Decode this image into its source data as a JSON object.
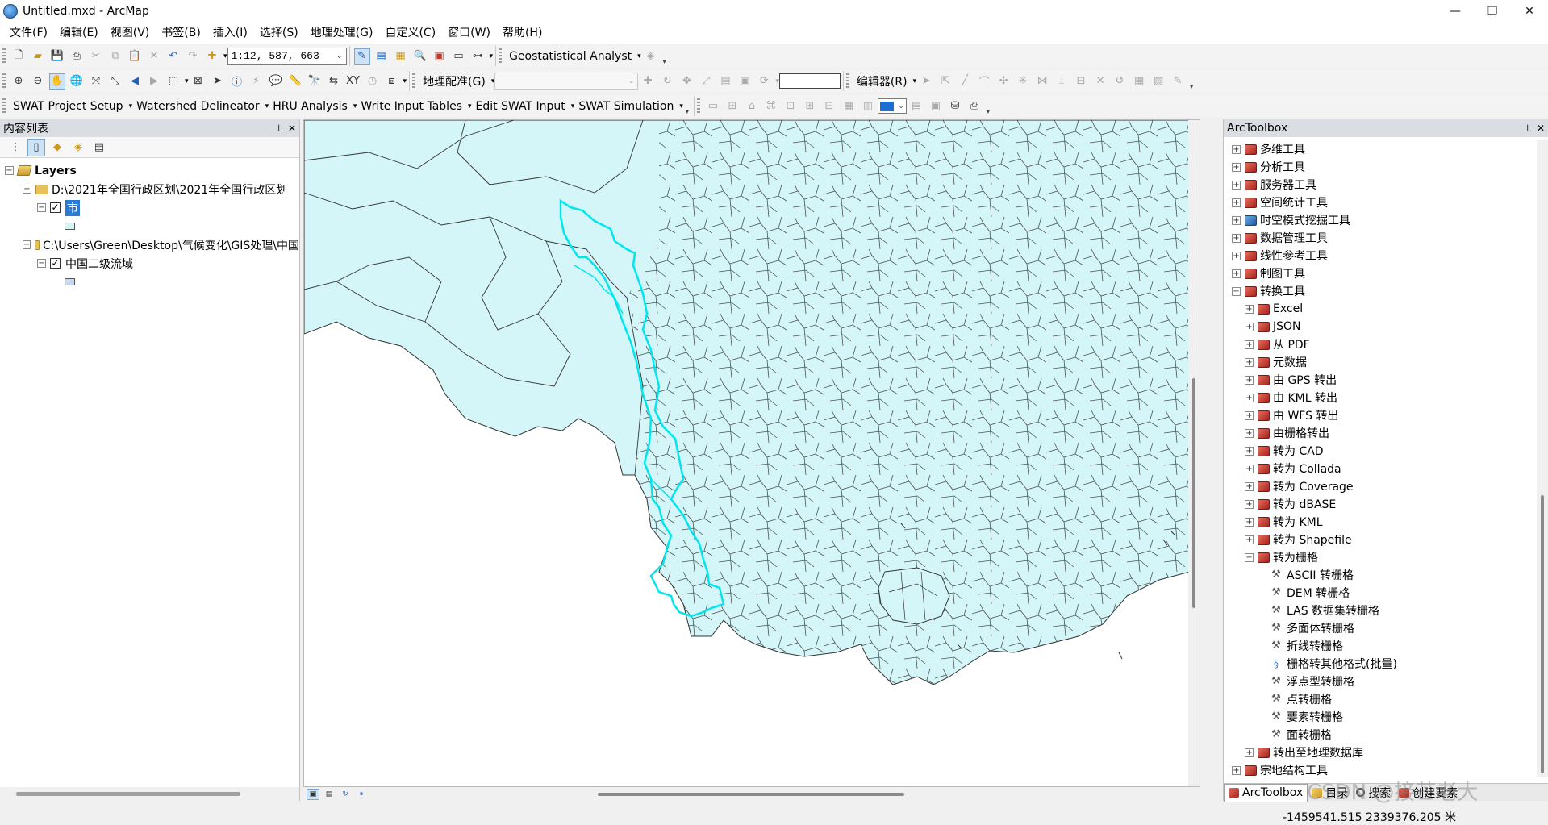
{
  "window": {
    "title": "Untitled.mxd - ArcMap",
    "minimize": "—",
    "maximize": "❐",
    "close": "✕"
  },
  "menu": [
    "文件(F)",
    "编辑(E)",
    "视图(V)",
    "书签(B)",
    "插入(I)",
    "选择(S)",
    "地理处理(G)",
    "自定义(C)",
    "窗口(W)",
    "帮助(H)"
  ],
  "standard_toolbar": {
    "scale": "1:12, 587, 663",
    "geostatistical": "Geostatistical Analyst"
  },
  "tools_toolbar": {
    "georeferencing": "地理配准(G)",
    "editor": "编辑器(R)"
  },
  "swat_toolbar": {
    "items": [
      "SWAT Project Setup",
      "Watershed Delineator",
      "HRU Analysis",
      "Write Input Tables",
      "Edit SWAT Input",
      "SWAT Simulation"
    ]
  },
  "toc": {
    "title": "内容列表",
    "root": "Layers",
    "group1": "D:\\2021年全国行政区划\\2021年全国行政区划",
    "layer1": "市",
    "group2": "C:\\Users\\Green\\Desktop\\气候变化\\GIS处理\\中国",
    "layer2": "中国二级流域",
    "colors": {
      "layer1_fill": "#d4f6f8",
      "layer2_fill": "#c8d8f0"
    }
  },
  "map": {
    "land_fill": "#d4f6f8",
    "boundary_color": "#333333",
    "basin_outline_color": "#00e5ee"
  },
  "toolbox": {
    "title": "ArcToolbox",
    "top_items": [
      "多维工具",
      "分析工具",
      "服务器工具",
      "空间统计工具",
      "时空模式挖掘工具",
      "数据管理工具",
      "线性参考工具",
      "制图工具"
    ],
    "conversion": "转换工具",
    "conversion_children": [
      "Excel",
      "JSON",
      "从 PDF",
      "元数据",
      "由 GPS 转出",
      "由 KML 转出",
      "由 WFS 转出",
      "由栅格转出",
      "转为 CAD",
      "转为 Collada",
      "转为 Coverage",
      "转为 dBASE",
      "转为 KML",
      "转为 Shapefile"
    ],
    "to_raster": "转为栅格",
    "to_raster_tools": [
      "ASCII 转栅格",
      "DEM 转栅格",
      "LAS 数据集转栅格",
      "多面体转栅格",
      "折线转栅格",
      "栅格转其他格式(批量)",
      "浮点型转栅格",
      "点转栅格",
      "要素转栅格",
      "面转栅格"
    ],
    "to_geodatabase": "转出至地理数据库",
    "parcel_tools": "宗地结构工具",
    "tabs": [
      "ArcToolbox",
      "目录",
      "搜索",
      "创建要素"
    ]
  },
  "status": {
    "coords": "-1459541.515  2339376.205 米",
    "watermark": "CSDN @接芒老大"
  }
}
